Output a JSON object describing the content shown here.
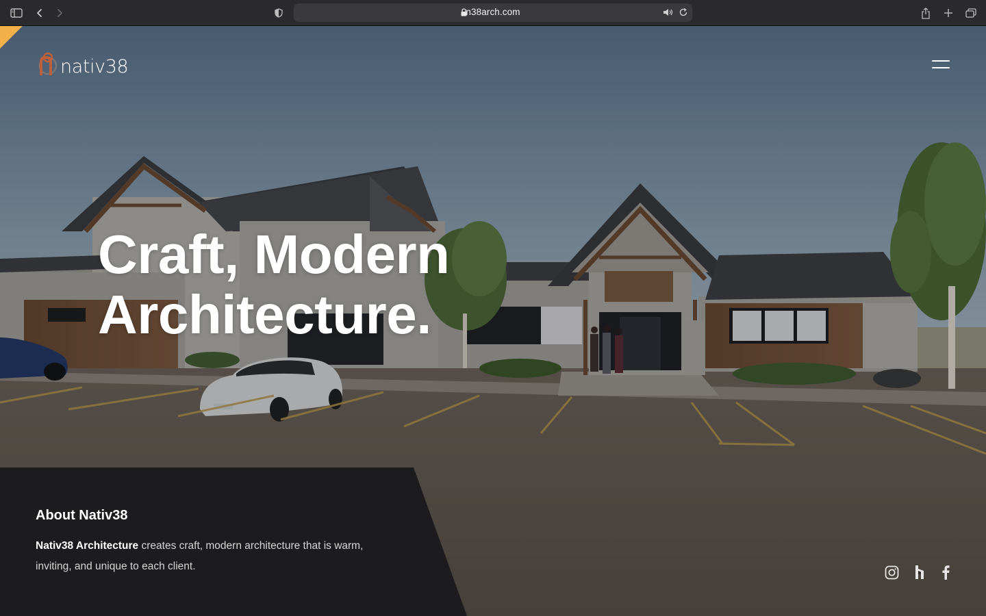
{
  "browser": {
    "url": "n38arch.com",
    "icons": [
      "sidebar-icon",
      "back-icon",
      "forward-icon",
      "shield-icon",
      "lock-icon",
      "speaker-icon",
      "reload-icon",
      "share-icon",
      "new-tab-icon",
      "tabs-overview-icon"
    ]
  },
  "site": {
    "brand_mark": "n",
    "brand_name": "nativ38",
    "menu_icon": "hamburger-menu-icon",
    "accent_color": "#f2b04a",
    "logo_color": "#c0603a"
  },
  "hero": {
    "headline_line1": "Craft, Modern",
    "headline_line2": "Architecture."
  },
  "about": {
    "title": "About Nativ38",
    "text_bold": "Nativ38 Architecture",
    "text_rest": " creates craft, modern architecture that is warm, inviting, and unique to each client."
  },
  "social": [
    "instagram-icon",
    "houzz-icon",
    "facebook-icon"
  ]
}
